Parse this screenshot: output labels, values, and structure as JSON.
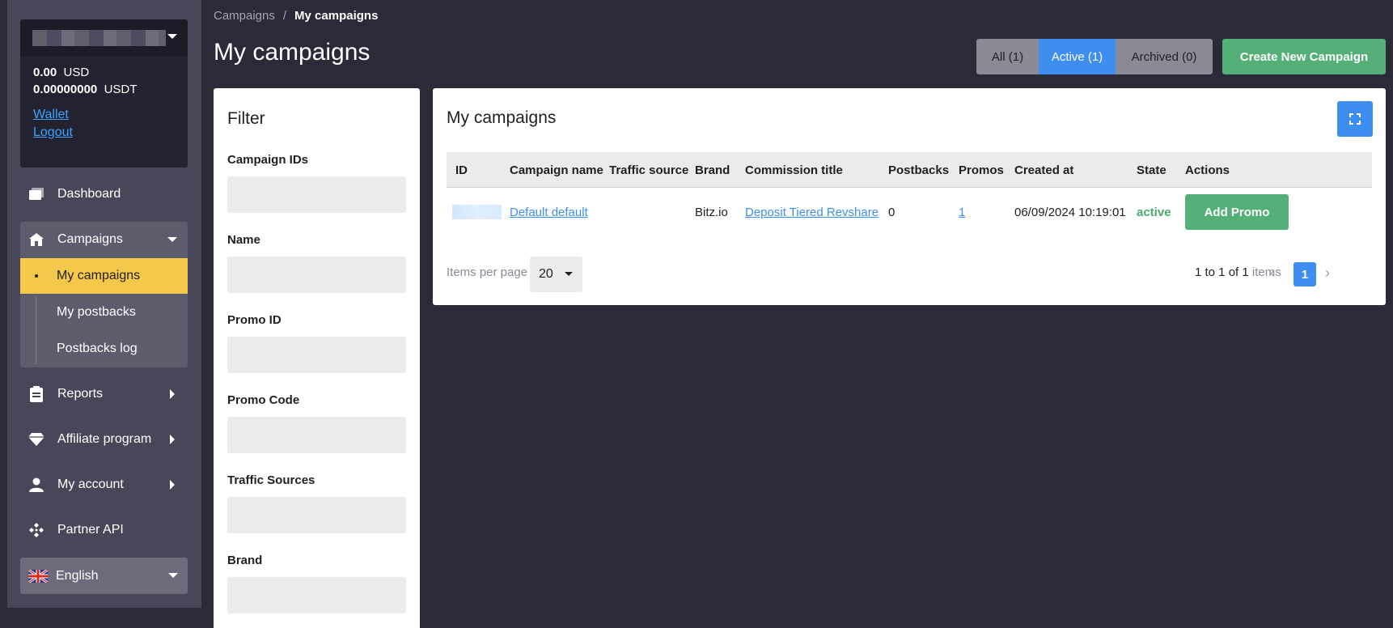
{
  "sidebar": {
    "account": {
      "name_masked": ""
    },
    "balances": [
      {
        "amount": "0.00",
        "currency": "USD"
      },
      {
        "amount": "0.00000000",
        "currency": "USDT"
      }
    ],
    "links": {
      "wallet": "Wallet",
      "logout": "Logout"
    },
    "nav": {
      "dashboard": "Dashboard",
      "campaigns": "Campaigns",
      "campaigns_sub": [
        "My campaigns",
        "My postbacks",
        "Postbacks log"
      ],
      "reports": "Reports",
      "affiliate_program": "Affiliate program",
      "my_account": "My account",
      "partner_api": "Partner API"
    },
    "language": "English"
  },
  "breadcrumb": {
    "parent": "Campaigns",
    "separator": "/",
    "current": "My campaigns"
  },
  "page_title": "My campaigns",
  "state_filter": {
    "all": "All (1)",
    "active": "Active (1)",
    "archived": "Archived (0)",
    "selected": "active"
  },
  "create_button": "Create New Campaign",
  "filter": {
    "title": "Filter",
    "fields": [
      {
        "label": "Campaign IDs",
        "value": ""
      },
      {
        "label": "Name",
        "value": ""
      },
      {
        "label": "Promo ID",
        "value": ""
      },
      {
        "label": "Promo Code",
        "value": ""
      },
      {
        "label": "Traffic Sources",
        "value": ""
      },
      {
        "label": "Brand",
        "value": ""
      }
    ]
  },
  "table": {
    "title": "My campaigns",
    "columns": [
      "ID",
      "Campaign name",
      "Traffic source",
      "Brand",
      "Commission title",
      "Postbacks",
      "Promos",
      "Created at",
      "State",
      "Actions"
    ],
    "rows": [
      {
        "id": "",
        "campaign_name": "Default default",
        "traffic_source": "",
        "brand": "Bitz.io",
        "commission_title": "Deposit Tiered Revshare",
        "postbacks": "0",
        "promos": "1",
        "created_at": "06/09/2024 10:19:01",
        "state": "active",
        "action": "Add Promo"
      }
    ],
    "items_per_page_label": "Items per page",
    "items_per_page": "20",
    "pager": {
      "range": "1 to 1 of 1",
      "suffix": "items",
      "current_page": "1"
    }
  },
  "colors": {
    "background": "#2b2a38",
    "sidebar": "#484759",
    "accent_blue": "#3d8ef0",
    "accent_green": "#55b077",
    "active_nav": "#f3c84b"
  }
}
